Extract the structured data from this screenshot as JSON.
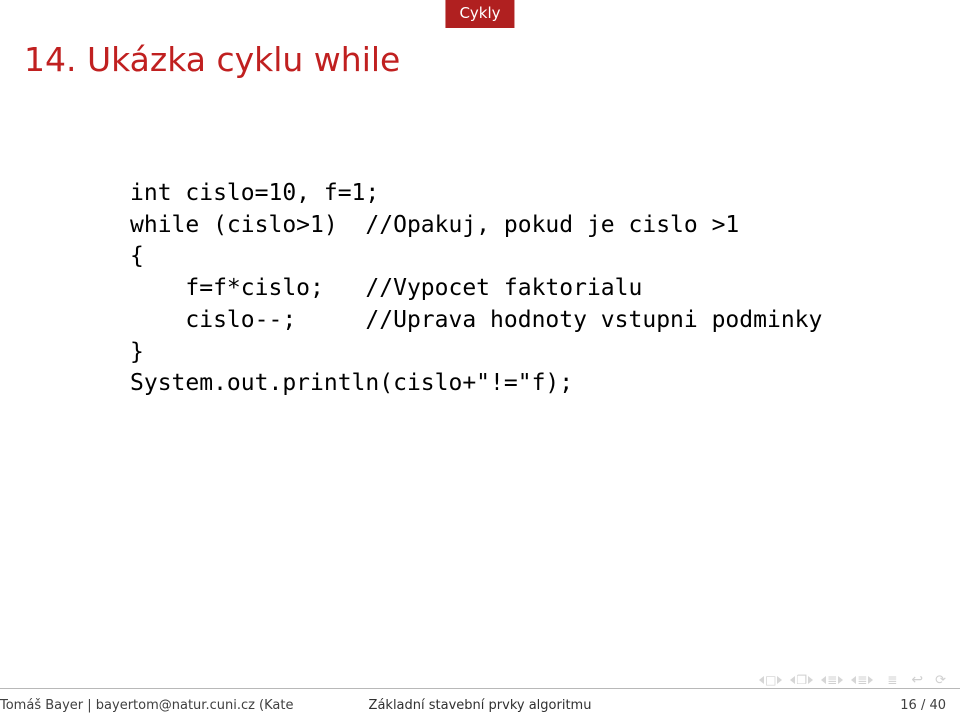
{
  "section": "Cykly",
  "title": "14. Ukázka cyklu while",
  "code": "int cislo=10, f=1;\nwhile (cislo>1)  //Opakuj, pokud je cislo >1\n{\n    f=f*cislo;   //Vypocet faktorialu\n    cislo--;     //Uprava hodnoty vstupni podminky\n}\nSystem.out.println(cislo+\"!=\"f);",
  "footer": {
    "author": "Tomáš Bayer | bayertom@natur.cuni.cz (Kate",
    "presentation_title": "Základní stavební prvky algoritmu",
    "page": "16 / 40"
  },
  "nav": {
    "slide_sym": "□",
    "frame_sym": "❐",
    "sub_sym": "≣",
    "sec_sym": "≣",
    "back_sym": "↩",
    "loop_sym": "⟳"
  }
}
